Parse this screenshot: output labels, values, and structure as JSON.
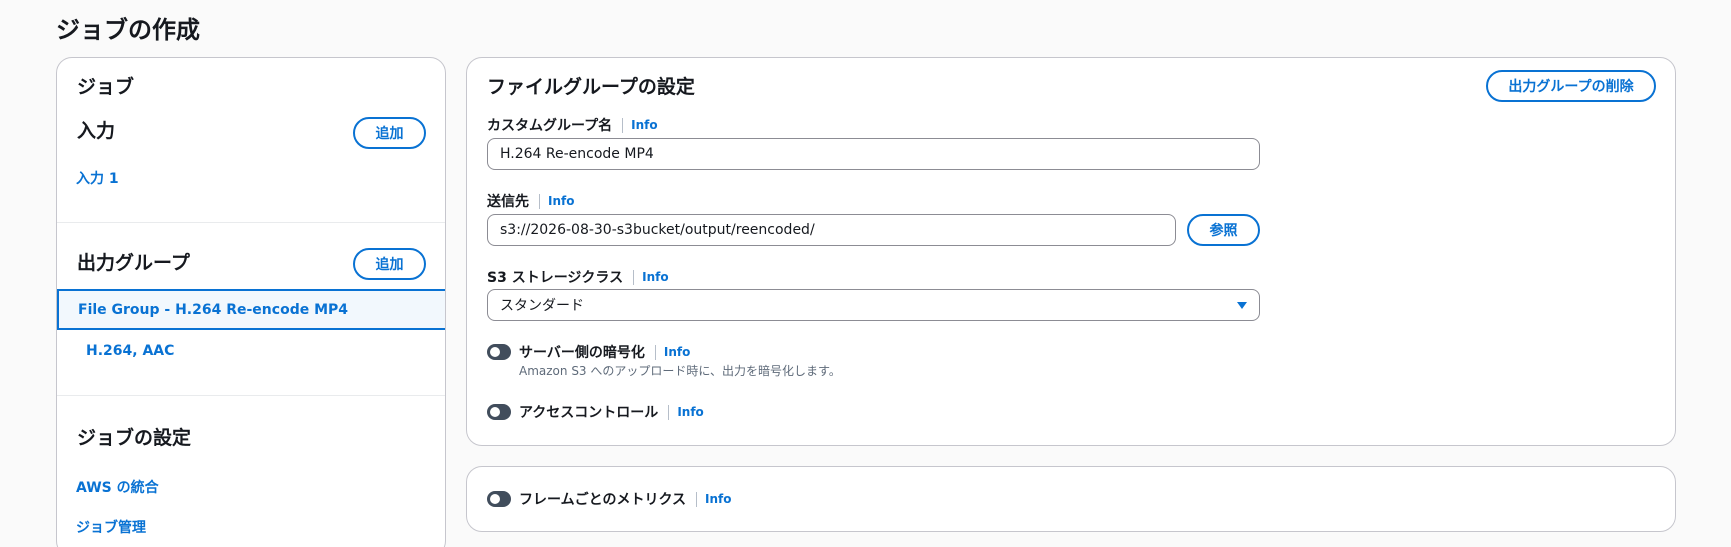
{
  "page": {
    "title": "ジョブの作成"
  },
  "left_panel": {
    "heading": "ジョブ",
    "inputs": {
      "title": "入力",
      "add_label": "追加",
      "items": [
        {
          "label": "入力 1"
        }
      ]
    },
    "output_groups": {
      "title": "出力グループ",
      "add_label": "追加",
      "selected": "File Group - H.264 Re-encode MP4",
      "outputs": [
        {
          "label": "H.264, AAC"
        }
      ]
    },
    "job_settings": {
      "title": "ジョブの設定",
      "items": [
        {
          "label": "AWS の統合"
        },
        {
          "label": "ジョブ管理"
        }
      ]
    }
  },
  "file_group": {
    "title": "ファイルグループの設定",
    "delete_label": "出力グループの削除",
    "info_label": "Info",
    "custom_name": {
      "label": "カスタムグループ名",
      "value": "H.264 Re-encode MP4"
    },
    "destination": {
      "label": "送信先",
      "value": "s3://2026-08-30-s3bucket/output/reencoded/",
      "browse_label": "参照"
    },
    "storage_class": {
      "label": "S3 ストレージクラス",
      "value": "スタンダード"
    },
    "encryption": {
      "label": "サーバー側の暗号化",
      "description": "Amazon S3 へのアップロード時に、出力を暗号化します。",
      "enabled": false
    },
    "access_control": {
      "label": "アクセスコントロール",
      "enabled": false
    }
  },
  "metrics": {
    "label": "フレームごとのメトリクス",
    "info_label": "Info",
    "enabled": false
  },
  "colors": {
    "accent": "#0972d3",
    "toggle_off": "#414d5c",
    "border": "#c6c6cd"
  },
  "icons": {
    "dropdown": "caret-down-icon"
  }
}
